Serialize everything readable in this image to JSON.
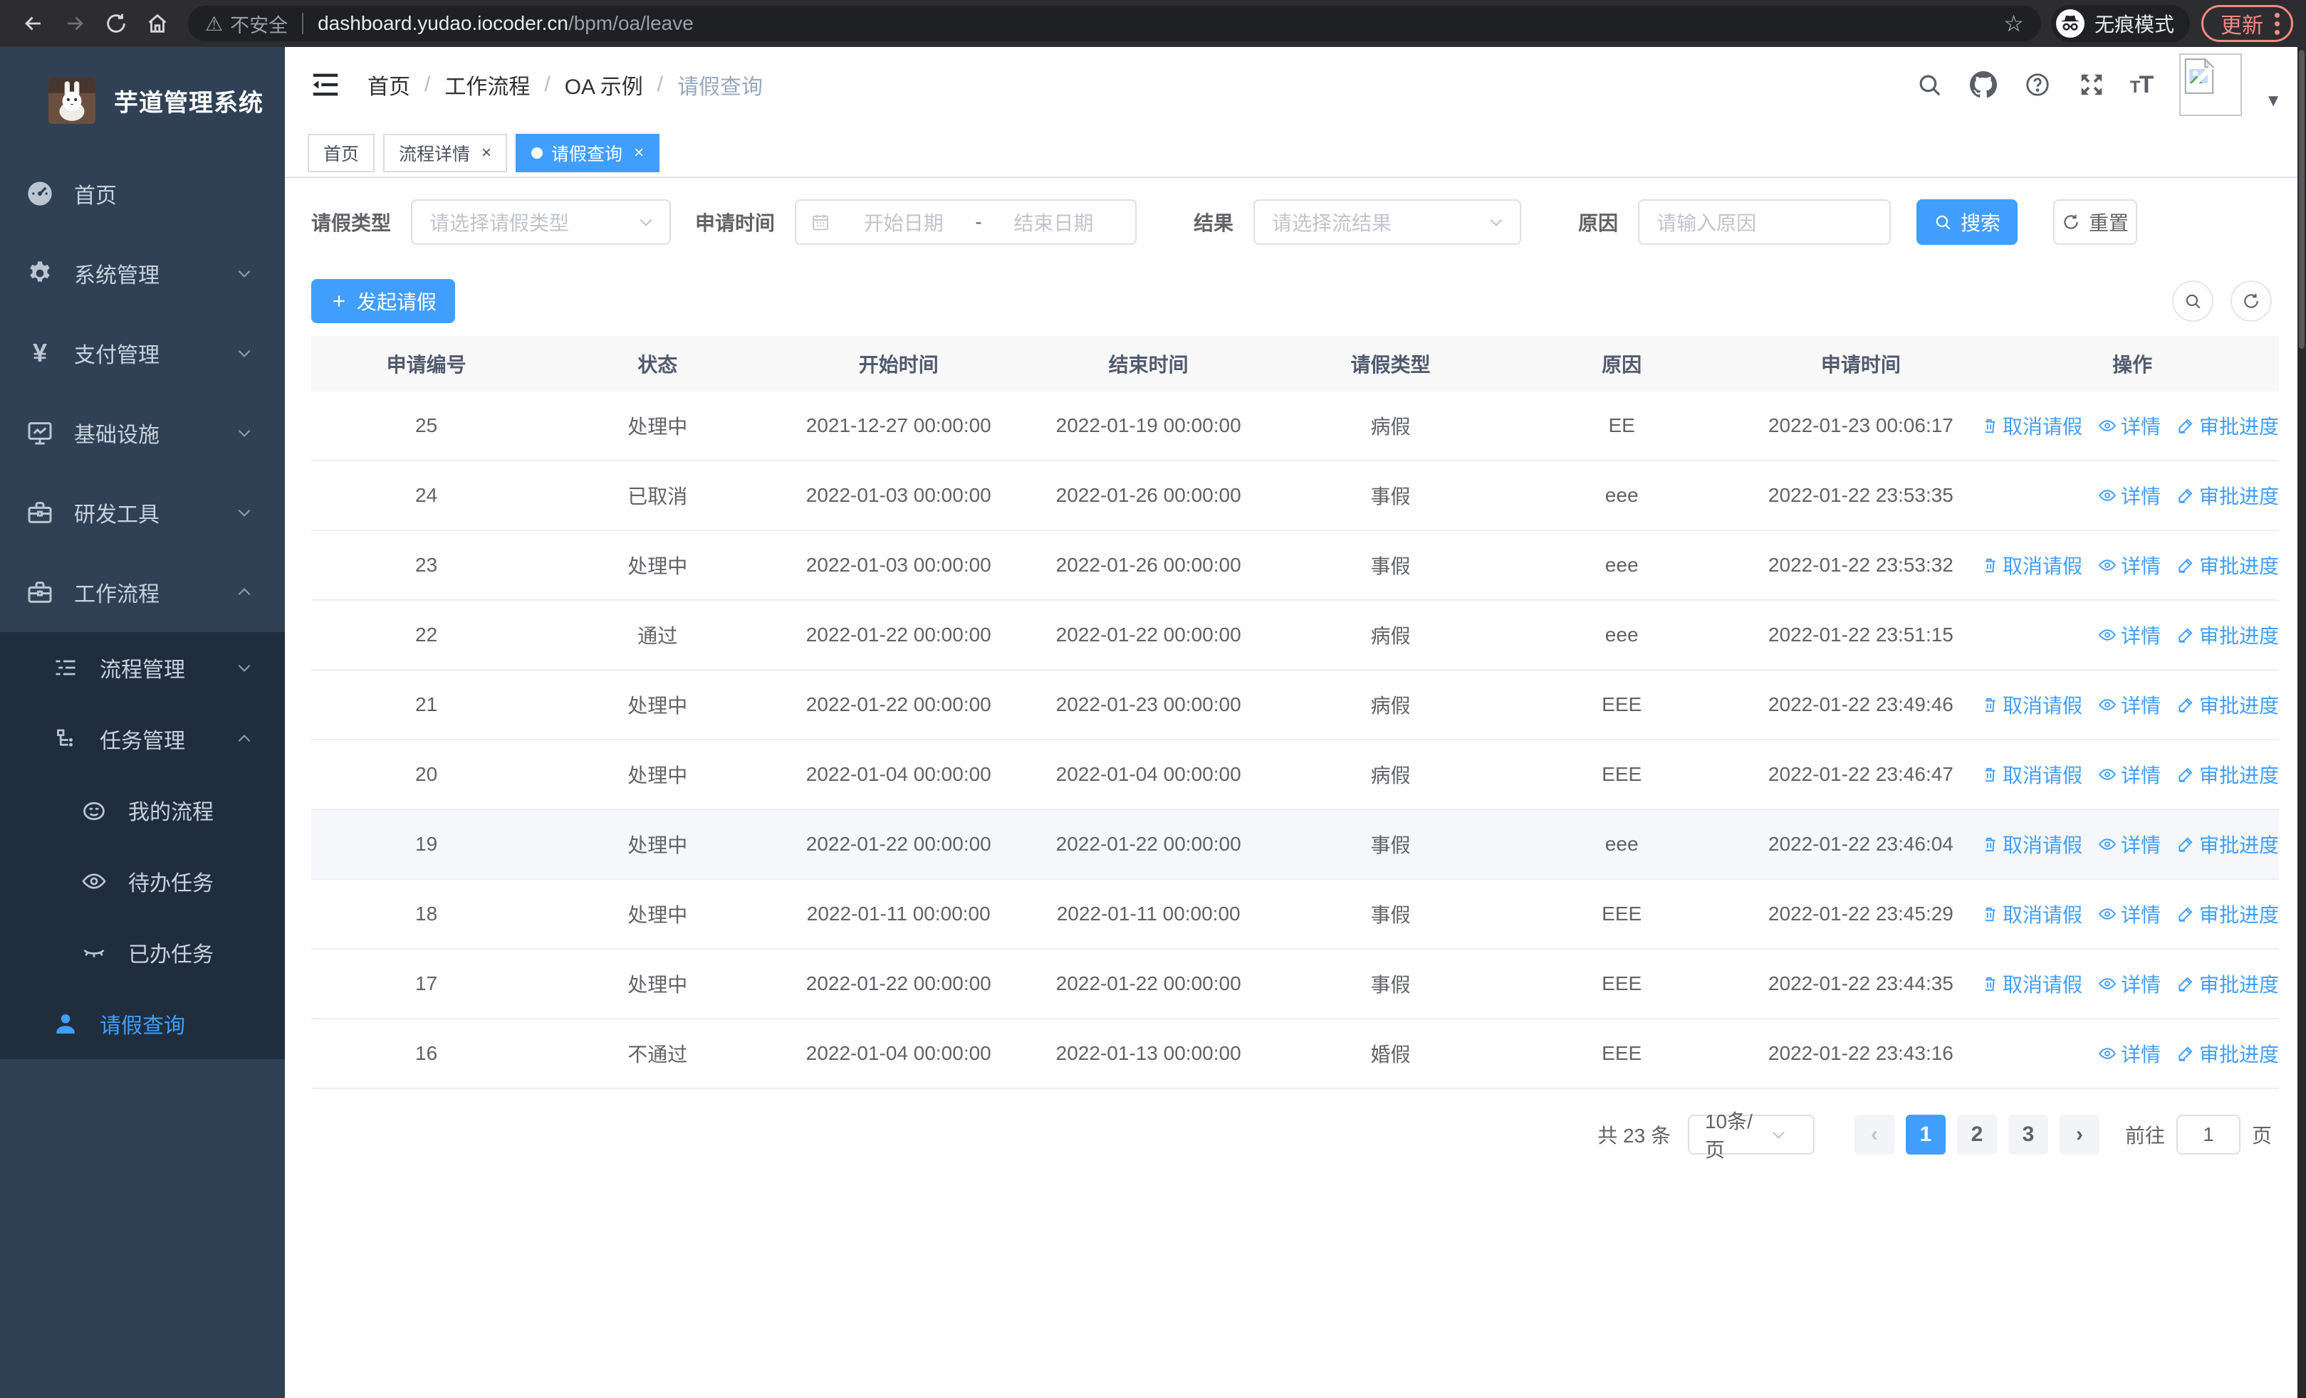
{
  "browser": {
    "security_label": "不安全",
    "url_host": "dashboard.yudao.iocoder.cn",
    "url_path": "/bpm/oa/leave",
    "incognito_label": "无痕模式",
    "update_label": "更新"
  },
  "colors": {
    "accent_blue": "#409EFF",
    "sidebar_bg": "#304156",
    "submenu_bg": "#1f2d3d",
    "update_pill": "#f28b82"
  },
  "sidebar": {
    "app_title": "芋道管理系统",
    "items": [
      {
        "label": "首页",
        "icon": "dashboard-icon",
        "level": 1,
        "expandable": false,
        "expanded": false,
        "in_submenu": false,
        "active": false
      },
      {
        "label": "系统管理",
        "icon": "gear-icon",
        "level": 1,
        "expandable": true,
        "expanded": false,
        "in_submenu": false,
        "active": false
      },
      {
        "label": "支付管理",
        "icon": "yen-icon",
        "level": 1,
        "expandable": true,
        "expanded": false,
        "in_submenu": false,
        "active": false
      },
      {
        "label": "基础设施",
        "icon": "monitor-icon",
        "level": 1,
        "expandable": true,
        "expanded": false,
        "in_submenu": false,
        "active": false
      },
      {
        "label": "研发工具",
        "icon": "toolbox-icon",
        "level": 1,
        "expandable": true,
        "expanded": false,
        "in_submenu": false,
        "active": false
      },
      {
        "label": "工作流程",
        "icon": "toolbox-icon",
        "level": 1,
        "expandable": true,
        "expanded": true,
        "in_submenu": false,
        "active": false
      },
      {
        "label": "流程管理",
        "icon": "list-tree-icon",
        "level": 2,
        "expandable": true,
        "expanded": false,
        "in_submenu": true,
        "active": false
      },
      {
        "label": "任务管理",
        "icon": "flow-icon",
        "level": 2,
        "expandable": true,
        "expanded": true,
        "in_submenu": true,
        "active": false
      },
      {
        "label": "我的流程",
        "icon": "face-icon",
        "level": 3,
        "expandable": false,
        "expanded": false,
        "in_submenu": true,
        "active": false
      },
      {
        "label": "待办任务",
        "icon": "eye-open-icon",
        "level": 3,
        "expandable": false,
        "expanded": false,
        "in_submenu": true,
        "active": false
      },
      {
        "label": "已办任务",
        "icon": "eye-closed-icon",
        "level": 3,
        "expandable": false,
        "expanded": false,
        "in_submenu": true,
        "active": false
      },
      {
        "label": "请假查询",
        "icon": "person-icon",
        "level": 2,
        "expandable": false,
        "expanded": false,
        "in_submenu": true,
        "active": true
      }
    ]
  },
  "header": {
    "breadcrumb": [
      "首页",
      "工作流程",
      "OA 示例",
      "请假查询"
    ]
  },
  "tabs": [
    {
      "label": "首页",
      "closable": false,
      "active": false
    },
    {
      "label": "流程详情",
      "closable": true,
      "active": false
    },
    {
      "label": "请假查询",
      "closable": true,
      "active": true
    }
  ],
  "filters": {
    "leave_type_label": "请假类型",
    "leave_type_placeholder": "请选择请假类型",
    "apply_time_label": "申请时间",
    "date_start_placeholder": "开始日期",
    "date_separator": "-",
    "date_end_placeholder": "结束日期",
    "result_label": "结果",
    "result_placeholder": "请选择流结果",
    "reason_label": "原因",
    "reason_placeholder": "请输入原因",
    "search_label": "搜索",
    "reset_label": "重置"
  },
  "toolbar": {
    "create_label": "发起请假"
  },
  "table": {
    "columns": [
      "申请编号",
      "状态",
      "开始时间",
      "结束时间",
      "请假类型",
      "原因",
      "申请时间",
      "操作"
    ],
    "action_labels": {
      "cancel": "取消请假",
      "detail": "详情",
      "progress": "审批进度"
    },
    "rows": [
      {
        "id": "25",
        "status": "处理中",
        "start": "2021-12-27 00:00:00",
        "end": "2022-01-19 00:00:00",
        "type": "病假",
        "reason": "EE",
        "apply_time": "2022-01-23 00:06:17",
        "actions": [
          "cancel",
          "detail",
          "progress"
        ],
        "highlighted": false
      },
      {
        "id": "24",
        "status": "已取消",
        "start": "2022-01-03 00:00:00",
        "end": "2022-01-26 00:00:00",
        "type": "事假",
        "reason": "eee",
        "apply_time": "2022-01-22 23:53:35",
        "actions": [
          "detail",
          "progress"
        ],
        "highlighted": false
      },
      {
        "id": "23",
        "status": "处理中",
        "start": "2022-01-03 00:00:00",
        "end": "2022-01-26 00:00:00",
        "type": "事假",
        "reason": "eee",
        "apply_time": "2022-01-22 23:53:32",
        "actions": [
          "cancel",
          "detail",
          "progress"
        ],
        "highlighted": false
      },
      {
        "id": "22",
        "status": "通过",
        "start": "2022-01-22 00:00:00",
        "end": "2022-01-22 00:00:00",
        "type": "病假",
        "reason": "eee",
        "apply_time": "2022-01-22 23:51:15",
        "actions": [
          "detail",
          "progress"
        ],
        "highlighted": false
      },
      {
        "id": "21",
        "status": "处理中",
        "start": "2022-01-22 00:00:00",
        "end": "2022-01-23 00:00:00",
        "type": "病假",
        "reason": "EEE",
        "apply_time": "2022-01-22 23:49:46",
        "actions": [
          "cancel",
          "detail",
          "progress"
        ],
        "highlighted": false
      },
      {
        "id": "20",
        "status": "处理中",
        "start": "2022-01-04 00:00:00",
        "end": "2022-01-04 00:00:00",
        "type": "病假",
        "reason": "EEE",
        "apply_time": "2022-01-22 23:46:47",
        "actions": [
          "cancel",
          "detail",
          "progress"
        ],
        "highlighted": false
      },
      {
        "id": "19",
        "status": "处理中",
        "start": "2022-01-22 00:00:00",
        "end": "2022-01-22 00:00:00",
        "type": "事假",
        "reason": "eee",
        "apply_time": "2022-01-22 23:46:04",
        "actions": [
          "cancel",
          "detail",
          "progress"
        ],
        "highlighted": true
      },
      {
        "id": "18",
        "status": "处理中",
        "start": "2022-01-11 00:00:00",
        "end": "2022-01-11 00:00:00",
        "type": "事假",
        "reason": "EEE",
        "apply_time": "2022-01-22 23:45:29",
        "actions": [
          "cancel",
          "detail",
          "progress"
        ],
        "highlighted": false
      },
      {
        "id": "17",
        "status": "处理中",
        "start": "2022-01-22 00:00:00",
        "end": "2022-01-22 00:00:00",
        "type": "事假",
        "reason": "EEE",
        "apply_time": "2022-01-22 23:44:35",
        "actions": [
          "cancel",
          "detail",
          "progress"
        ],
        "highlighted": false
      },
      {
        "id": "16",
        "status": "不通过",
        "start": "2022-01-04 00:00:00",
        "end": "2022-01-13 00:00:00",
        "type": "婚假",
        "reason": "EEE",
        "apply_time": "2022-01-22 23:43:16",
        "actions": [
          "detail",
          "progress"
        ],
        "highlighted": false
      }
    ]
  },
  "pagination": {
    "total_label": "共 23 条",
    "page_size": "10条/页",
    "pages": [
      "1",
      "2",
      "3"
    ],
    "active_page": "1",
    "goto_label": "前往",
    "goto_value": "1",
    "page_suffix": "页"
  }
}
